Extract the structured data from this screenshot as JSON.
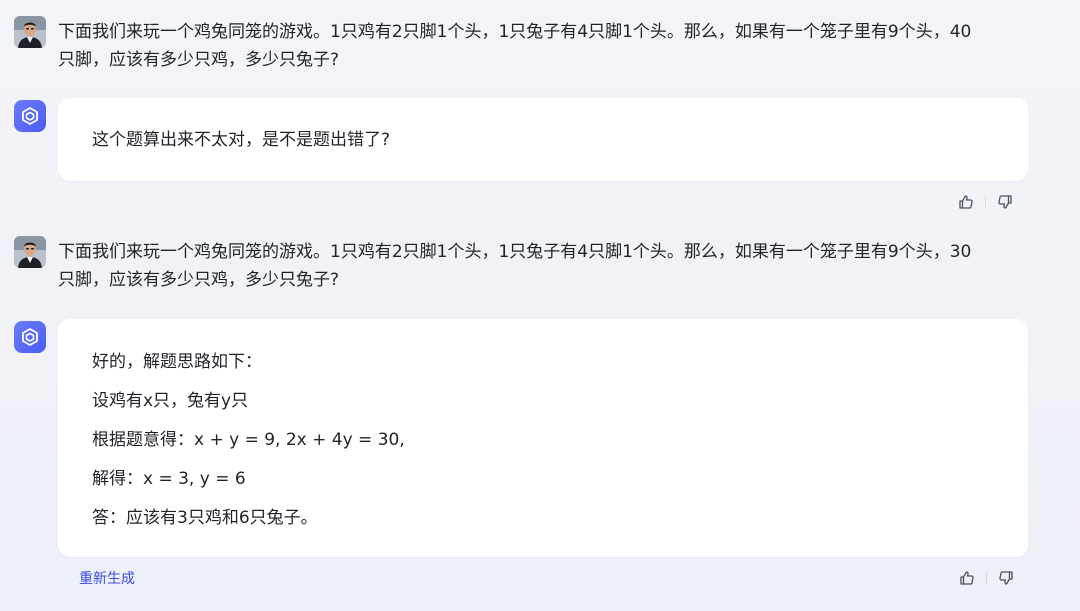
{
  "conversation": [
    {
      "role": "user",
      "lines": [
        "下面我们来玩一个鸡兔同笼的游戏。1只鸡有2只脚1个头，1只兔子有4只脚1个头。那么，如果有一个笼子里有9个头，40",
        "只脚，应该有多少只鸡，多少只兔子?"
      ]
    },
    {
      "role": "assistant",
      "lines": [
        "这个题算出来不太对，是不是题出错了?"
      ]
    },
    {
      "role": "user",
      "lines": [
        "下面我们来玩一个鸡兔同笼的游戏。1只鸡有2只脚1个头，1只兔子有4只脚1个头。那么，如果有一个笼子里有9个头，30",
        "只脚，应该有多少只鸡，多少只兔子?"
      ]
    },
    {
      "role": "assistant",
      "lines": [
        "好的，解题思路如下：",
        "设鸡有x只，兔有y只",
        "根据题意得：x + y = 9, 2x + 4y = 30,",
        "解得：x = 3, y = 6",
        "答：应该有3只鸡和6只兔子。"
      ]
    }
  ],
  "actions": {
    "regenerate_label": "重新生成"
  },
  "icons": {
    "bot_avatar": "bot-logo-icon",
    "like": "thumbs-up-icon",
    "dislike": "thumbs-down-icon"
  },
  "colors": {
    "accent": "#4a5cf0",
    "link": "#3b4de0",
    "background": "#f1f2f8",
    "card": "#ffffff",
    "text": "#1f2329"
  }
}
